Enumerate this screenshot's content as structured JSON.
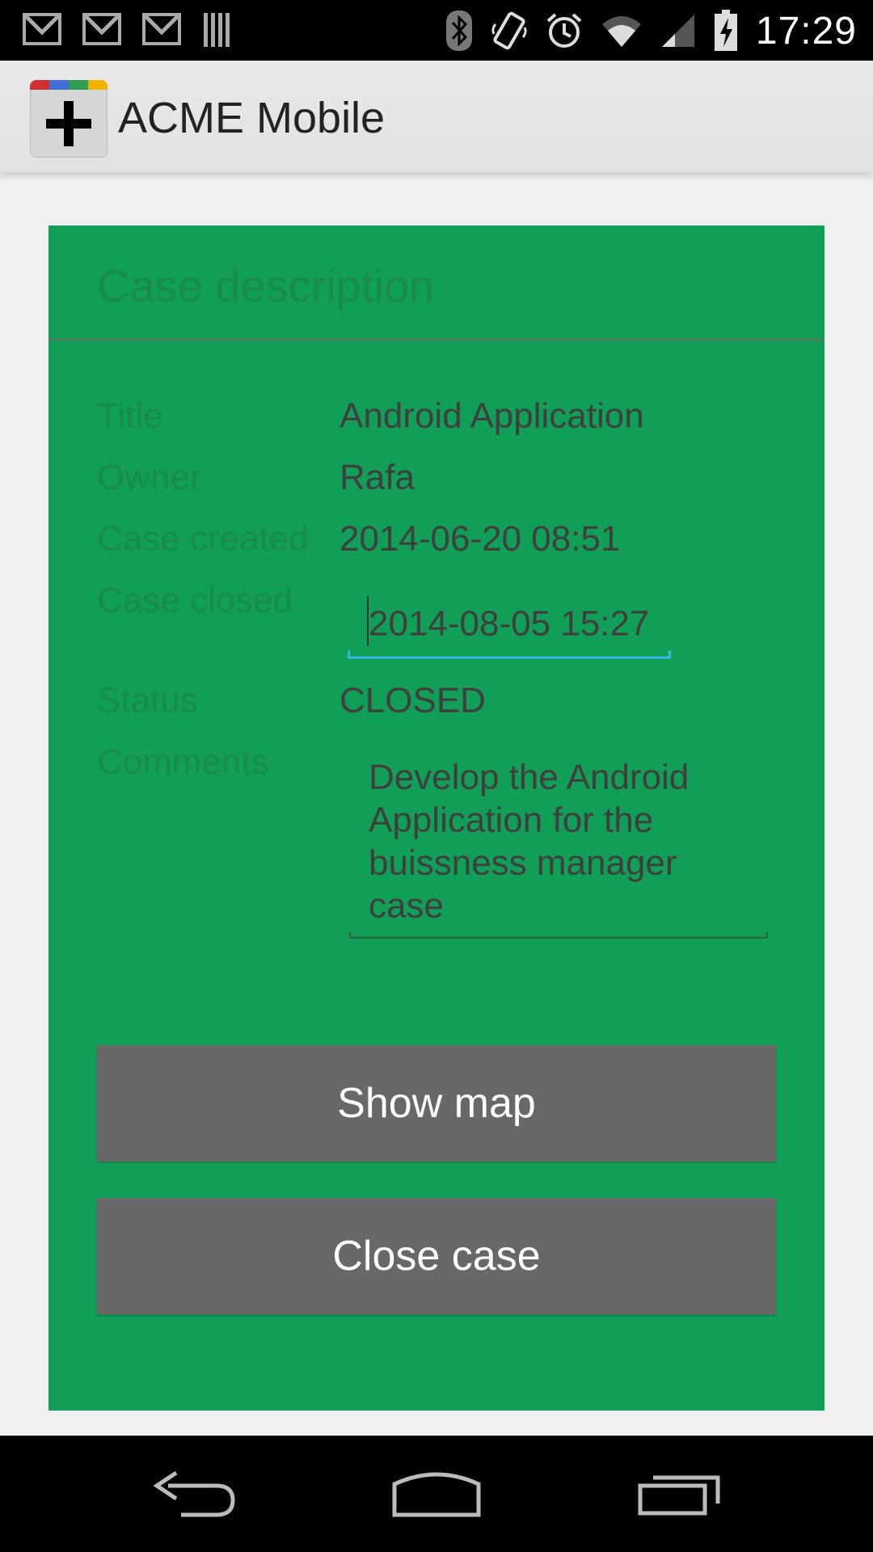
{
  "status_bar": {
    "time": "17:29",
    "left_icons": [
      "gmail-icon",
      "gmail-icon",
      "gmail-icon",
      "barcode-icon"
    ],
    "right_icons": [
      "bluetooth-icon",
      "vibrate-icon",
      "alarm-icon",
      "wifi-icon",
      "signal-icon",
      "battery-charging-icon"
    ]
  },
  "action_bar": {
    "app_title": "ACME Mobile",
    "icon": "app-plus-icon"
  },
  "case": {
    "header": "Case description",
    "fields": [
      {
        "label": "Title",
        "value": "Android Application"
      },
      {
        "label": "Owner",
        "value": "Rafa"
      },
      {
        "label": "Case created",
        "value": "2014-06-20 08:51"
      },
      {
        "label": "Case closed",
        "value": "2014-08-05 15:27"
      },
      {
        "label": "Status",
        "value": "CLOSED"
      },
      {
        "label": "Comments",
        "value": "Develop the Android Application for the buissness manager case"
      }
    ]
  },
  "buttons": {
    "show_map": "Show map",
    "close_case": "Close case"
  },
  "nav_bar": {
    "icons": [
      "back-icon",
      "home-icon",
      "recents-icon"
    ]
  },
  "colors": {
    "card_background": "#119e57",
    "button_background": "#686868",
    "focus_underline": "#33b5e5"
  }
}
